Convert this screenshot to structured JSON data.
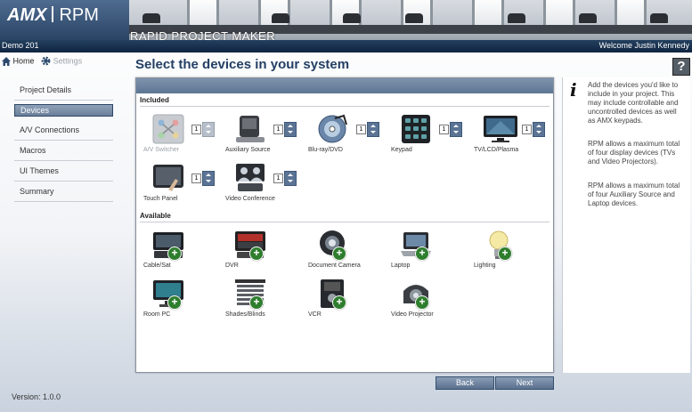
{
  "header": {
    "logo_brand": "AMX",
    "logo_product": "RPM",
    "tagline": "RAPID PROJECT MAKER",
    "project_name": "Demo 201",
    "welcome": "Welcome Justin Kennedy",
    "home_label": "Home",
    "settings_label": "Settings"
  },
  "sidebar": {
    "items": [
      {
        "label": "Project Details"
      },
      {
        "label": "Devices",
        "active": true
      },
      {
        "label": "A/V Connections"
      },
      {
        "label": "Macros"
      },
      {
        "label": "UI Themes"
      },
      {
        "label": "Summary"
      }
    ],
    "version": "Version: 1.0.0"
  },
  "main": {
    "title": "Select the devices in your system",
    "included_heading": "Included",
    "available_heading": "Available",
    "included": [
      {
        "label": "A/V Switcher",
        "qty": "1",
        "icon": "av-switcher-icon",
        "disabled": true
      },
      {
        "label": "Auxiliary Source",
        "qty": "1",
        "icon": "auxiliary-source-icon"
      },
      {
        "label": "Blu-ray/DVD",
        "qty": "1",
        "icon": "bluray-dvd-icon"
      },
      {
        "label": "Keypad",
        "qty": "1",
        "icon": "keypad-icon"
      },
      {
        "label": "TV/LCD/Plasma",
        "qty": "1",
        "icon": "tv-lcd-plasma-icon"
      },
      {
        "label": "Touch Panel",
        "qty": "1",
        "icon": "touch-panel-icon"
      },
      {
        "label": "Video Conference",
        "qty": "1",
        "icon": "video-conference-icon"
      }
    ],
    "available": [
      {
        "label": "Cable/Sat",
        "icon": "cable-sat-icon"
      },
      {
        "label": "DVR",
        "icon": "dvr-icon"
      },
      {
        "label": "Document Camera",
        "icon": "document-camera-icon"
      },
      {
        "label": "Laptop",
        "icon": "laptop-icon"
      },
      {
        "label": "Lighting",
        "icon": "lighting-icon"
      },
      {
        "label": "Room PC",
        "icon": "room-pc-icon"
      },
      {
        "label": "Shades/Blinds",
        "icon": "shades-blinds-icon"
      },
      {
        "label": "VCR",
        "icon": "vcr-icon"
      },
      {
        "label": "Video Projector",
        "icon": "video-projector-icon"
      }
    ]
  },
  "info": {
    "help_label": "?",
    "paragraphs": [
      "Add the devices you'd like to include in your project. This may include controllable and uncontrolled devices as well as AMX keypads.",
      "RPM allows a maximum total of four display devices (TVs and Video Projectors).",
      "RPM allows a maximum total of four Auxiliary Source and Laptop devices."
    ]
  },
  "buttons": {
    "back": "Back",
    "next": "Next"
  },
  "colors": {
    "accent": "#244064",
    "header_bar": "#1a3251",
    "add_green": "#2f7e2e"
  }
}
